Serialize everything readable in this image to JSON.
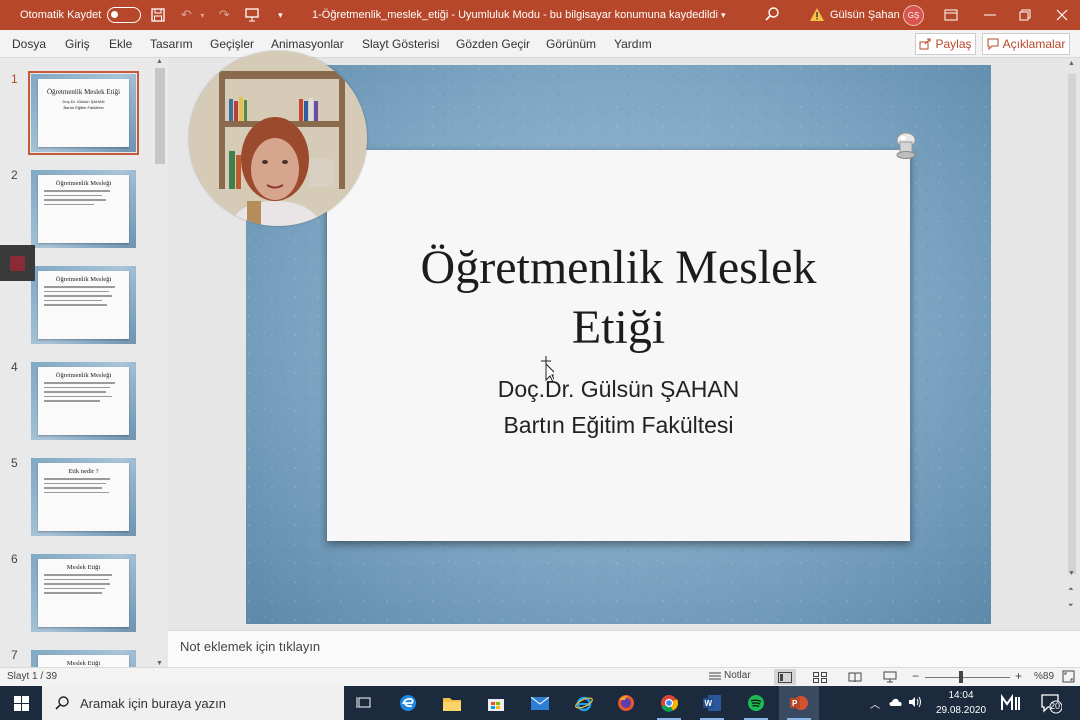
{
  "titlebar": {
    "autosave_label": "Otomatik Kaydet",
    "document_title": "1-Öğretmenlik_meslek_etiği  -  Uyumluluk Modu  -  bu bilgisayar konumuna kaydedildi",
    "user_name": "Gülsün Şahan",
    "user_initials": "GŞ"
  },
  "ribbon": {
    "tabs": [
      "Dosya",
      "Giriş",
      "Ekle",
      "Tasarım",
      "Geçişler",
      "Animasyonlar",
      "Slayt Gösterisi",
      "Gözden Geçir",
      "Görünüm",
      "Yardım"
    ],
    "share_label": "Paylaş",
    "comments_label": "Açıklamalar"
  },
  "thumbnails": {
    "slide_numbers": [
      "1",
      "2",
      "3",
      "4",
      "5",
      "6",
      "7"
    ],
    "titles": [
      "Öğretmenlik Meslek Etiği",
      "Öğretmenlik Mesleği",
      "Öğretmenlik Mesleği",
      "Öğretmenlik Mesleği",
      "Etik nedir ?",
      "Meslek Etiği",
      "Meslek Etiği"
    ],
    "slide1_sub1": "Doç.Dr. Gülsün ŞAHAN",
    "slide1_sub2": "Bartın Eğitim Fakültesi"
  },
  "slide": {
    "title_line1": "Öğretmenlik Meslek",
    "title_line2": "Etiği",
    "subtitle_line1": "Doç.Dr. Gülsün ŞAHAN",
    "subtitle_line2": "Bartın Eğitim Fakültesi"
  },
  "notes": {
    "placeholder": "Not eklemek için tıklayın"
  },
  "statusbar": {
    "slide_count": "Slayt 1 / 39",
    "notes_label": "Notlar",
    "zoom_level": "%89",
    "zoom_fraction": 0.42
  },
  "taskbar": {
    "search_placeholder": "Aramak için buraya yazın",
    "time": "14:04",
    "date": "29.08.2020",
    "notification_count": "20"
  },
  "colors": {
    "accent": "#b7472a",
    "taskbar": "#1c2a3d"
  }
}
